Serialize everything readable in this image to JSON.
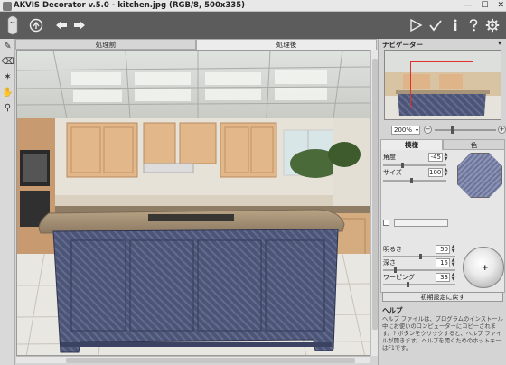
{
  "window": {
    "title": "AKVIS Decorator v.5.0 - kitchen.jpg (RGB/8, 500x335)",
    "controls": [
      "minimize",
      "maximize",
      "close"
    ]
  },
  "toolbar": {
    "left_icons": [
      "akvis-logo-icon",
      "open-image-icon",
      "undo-icon",
      "redo-icon"
    ],
    "right_icons": [
      "run-icon",
      "apply-check-icon",
      "info-icon",
      "help-icon",
      "settings-gear-icon"
    ]
  },
  "left_tools": [
    "selection-brush-icon",
    "eraser-icon",
    "magic-brush-icon",
    "hand-icon",
    "zoom-icon"
  ],
  "view_tabs": {
    "before": "処理前",
    "after": "処理後"
  },
  "navigator": {
    "title": "ナビゲーター",
    "zoom": "200%"
  },
  "settings_tabs": {
    "texture": "模様",
    "color": "色"
  },
  "settings": {
    "angle_label": "角度",
    "angle_value": "-45",
    "size_label": "サイズ",
    "size_value": "100",
    "brightness_label": "明るさ",
    "brightness_value": "50",
    "depth_label": "深さ",
    "depth_value": "15",
    "warping_label": "ワーピング",
    "warping_value": "33",
    "reset_label": "初期設定に戻す"
  },
  "help": {
    "title": "ヘルプ",
    "text": "ヘルプ ファイルは、プログラムのインストール中にお使いのコンピューターにコピーされます。? ボタンをクリックすると、ヘルプ ファイルが開きます。ヘルプを開くためのホットキーはF1です。"
  },
  "colors": {
    "toolbar": "#5c5c5c",
    "panel": "#d4d4d4",
    "island_texture": "#4d5577",
    "nav_frame": "#e0302a"
  }
}
